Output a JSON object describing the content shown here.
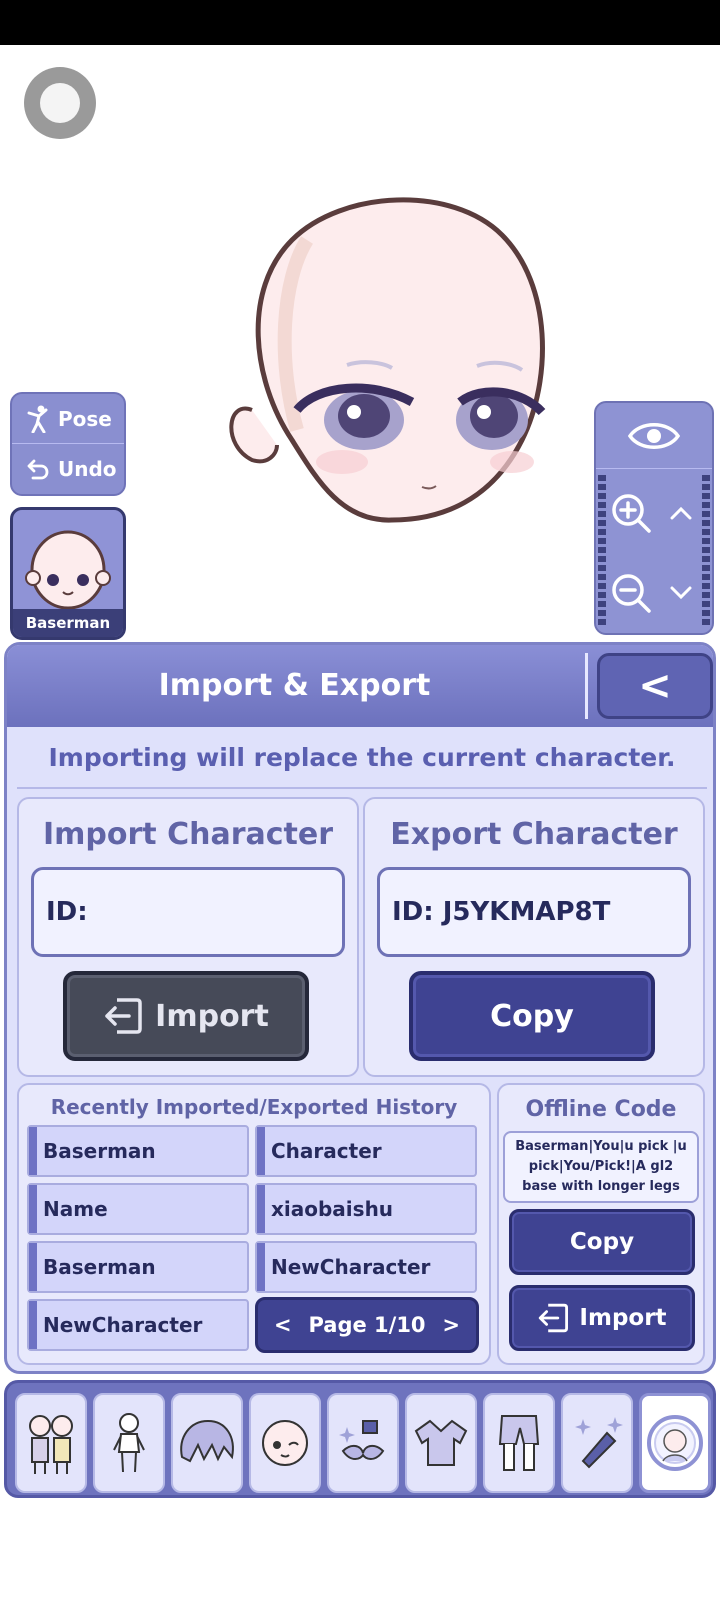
{
  "left_controls": {
    "pose_label": "Pose",
    "undo_label": "Undo",
    "character_name": "Baserman"
  },
  "panel": {
    "title": "Import & Export",
    "back_label": "<",
    "warning": "Importing will replace the current character.",
    "import": {
      "title": "Import Character",
      "id_value": "ID:",
      "button_label": "Import"
    },
    "export": {
      "title": "Export Character",
      "id_value": "ID: J5YKMAP8T",
      "button_label": "Copy"
    },
    "history": {
      "title": "Recently Imported/Exported History",
      "items": [
        "Baserman",
        "Character",
        "Name",
        "xiaobaishu",
        "Baserman",
        "NewCharacter",
        "NewCharacter"
      ],
      "page_label": "Page 1/10"
    },
    "offline": {
      "title": "Offline Code",
      "lines": [
        "Baserman|You|u pick |u",
        "pick|You/Pick!|A gl2",
        "base with longer legs"
      ],
      "copy_label": "Copy",
      "import_label": "Import"
    }
  },
  "tabs": [
    "presets-icon",
    "body-icon",
    "hair-icon",
    "face-icon",
    "accessories-icon",
    "top-clothing-icon",
    "bottom-clothing-icon",
    "effects-icon",
    "profile-icon"
  ],
  "colors": {
    "accent": "#3f4392",
    "panel": "#dfe1fb",
    "header": "#7a7fc8",
    "dark_button": "#464a58"
  }
}
